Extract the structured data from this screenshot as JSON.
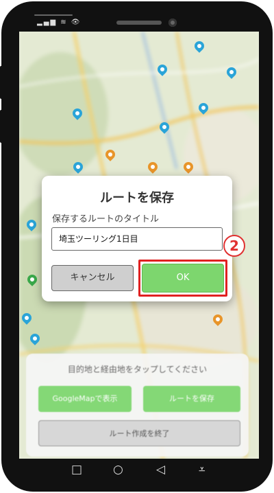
{
  "status_bar": {
    "icons": "▂▄▆ ≋ 👁"
  },
  "dialog": {
    "title": "ルートを保存",
    "label": "保存するルートのタイトル",
    "input_value": "埼玉ツーリング1日目",
    "cancel_label": "キャンセル",
    "ok_label": "OK"
  },
  "step_marker": "2",
  "bottom_panel": {
    "instruction": "目的地と経由地をタップしてください",
    "googlemap_button": "GoogleMapで表示",
    "save_route_button": "ルートを保存",
    "end_button": "ルート作成を終了"
  },
  "nav_bar": {
    "overview": "□",
    "home": "○",
    "back": "◁",
    "menu": "⩡"
  },
  "colors": {
    "ok_green": "#7dd66e",
    "highlight_red": "#e02020",
    "pin_blue": "#2aa4d8",
    "pin_orange": "#e8952a"
  }
}
